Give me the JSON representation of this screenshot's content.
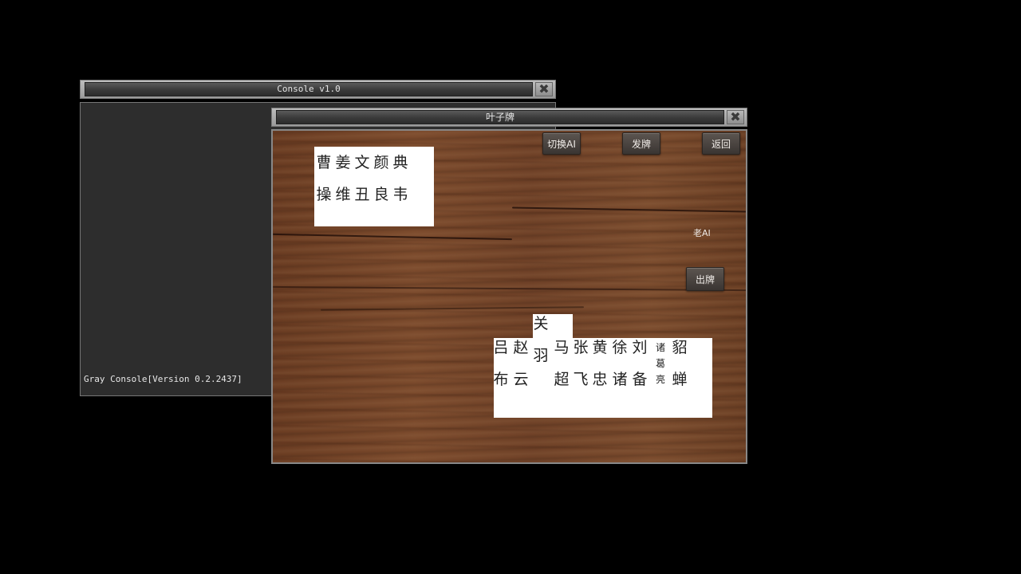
{
  "console": {
    "title": "Console v1.0",
    "close_glyph": "✖",
    "version_line": "Gray Console[Version 0.2.2437]"
  },
  "game": {
    "title": "叶子牌",
    "close_glyph": "✖",
    "buttons": {
      "switch_ai": "切换AI",
      "deal": "发牌",
      "back": "返回",
      "play": "出牌"
    },
    "ai_label": "老AI",
    "opponent_cards": [
      {
        "name": "曹\n操"
      },
      {
        "name": "姜\n维"
      },
      {
        "name": "文\n丑"
      },
      {
        "name": "颜\n良"
      },
      {
        "name": "典\n韦"
      }
    ],
    "player_cards": [
      {
        "name": "吕\n布"
      },
      {
        "name": "赵\n云"
      },
      {
        "name": "关\n羽",
        "raised": true
      },
      {
        "name": "马\n超"
      },
      {
        "name": "张\n飞"
      },
      {
        "name": "黄\n忠"
      },
      {
        "name": "徐\n诸"
      },
      {
        "name": "刘\n备"
      },
      {
        "name": "诸\n葛\n亮",
        "small": true
      },
      {
        "name": "貂\n蝉"
      }
    ]
  }
}
